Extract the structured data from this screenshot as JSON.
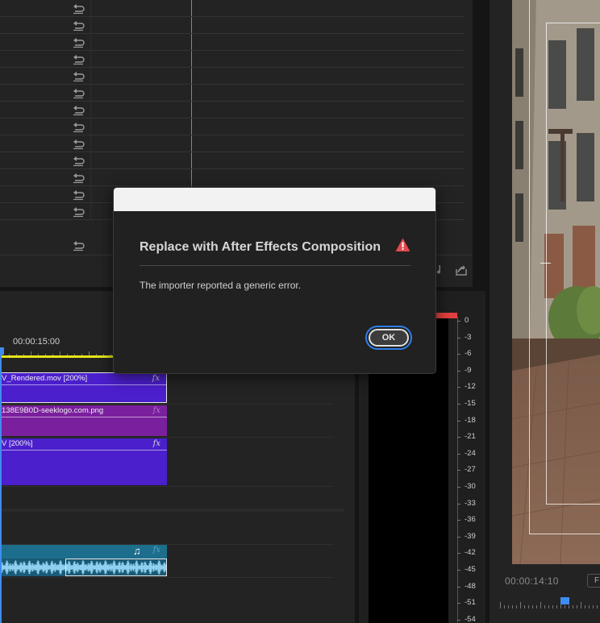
{
  "dialog": {
    "title": "Replace with After Effects Composition",
    "message": "The importer reported a generic error.",
    "ok_label": "OK",
    "alert_color": "#e34850"
  },
  "timeline": {
    "timecode": "00:00:15:00",
    "clips": [
      {
        "name": "V_Rendered.mov [200%]",
        "fx": "fx",
        "color": "#4b1fcc"
      },
      {
        "name": "138E9B0D-seeklogo.com.png",
        "fx": "fx",
        "color": "#7a1f9e"
      },
      {
        "name": "V [200%]",
        "fx": "fx",
        "color": "#4b1fcc"
      }
    ],
    "audio_clip": {
      "icon": "music-note-icon",
      "fx": "fx",
      "color": "#1c6e8c"
    }
  },
  "audio_meter": {
    "scale": [
      "0",
      "-3",
      "-6",
      "-9",
      "-12",
      "-15",
      "-18",
      "-21",
      "-24",
      "-27",
      "-30",
      "-33",
      "-36",
      "-39",
      "-42",
      "-45",
      "-48",
      "-51",
      "-54"
    ],
    "clip_indicator_color": "#e13f3f"
  },
  "program_monitor": {
    "timecode": "00:00:14:10",
    "fit_label": "F"
  },
  "effect_controls": {
    "reset_icon": "reset-icon"
  }
}
